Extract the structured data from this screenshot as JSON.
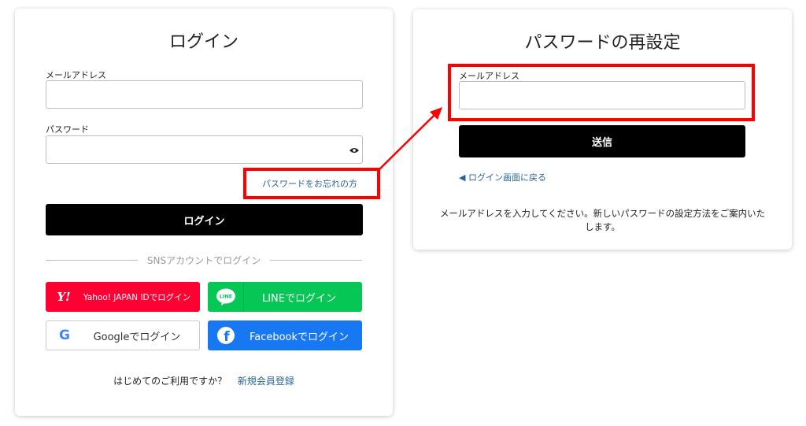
{
  "login": {
    "title": "ログイン",
    "email_label": "メールアドレス",
    "email_value": "",
    "password_label": "パスワード",
    "password_value": "",
    "forgot_link": "パスワードをお忘れの方",
    "login_button": "ログイン",
    "sns_divider": "SNSアカウントでログイン",
    "sns": {
      "yahoo": "Yahoo! JAPAN IDでログイン",
      "line": "LINEでログイン",
      "google": "Googleでログイン",
      "facebook": "Facebookでログイン"
    },
    "footer_question": "はじめてのご利用ですか？",
    "register_link": "新規会員登録"
  },
  "reset": {
    "title": "パスワードの再設定",
    "email_label": "メールアドレス",
    "email_value": "",
    "send_button": "送信",
    "back_link": "◀ ログイン画面に戻る",
    "description": "メールアドレスを入力してください。新しいパスワードの設定方法をご案内いたします。"
  },
  "icons": {
    "yahoo_icon_text": "Y!",
    "line_icon_text": "LINE",
    "google_icon_text": "G",
    "facebook_icon_text": "f"
  },
  "colors": {
    "highlight": "#ff0000",
    "yahoo": "#ff0033",
    "line": "#06c755",
    "facebook": "#1877f2",
    "link": "#2a6496"
  }
}
